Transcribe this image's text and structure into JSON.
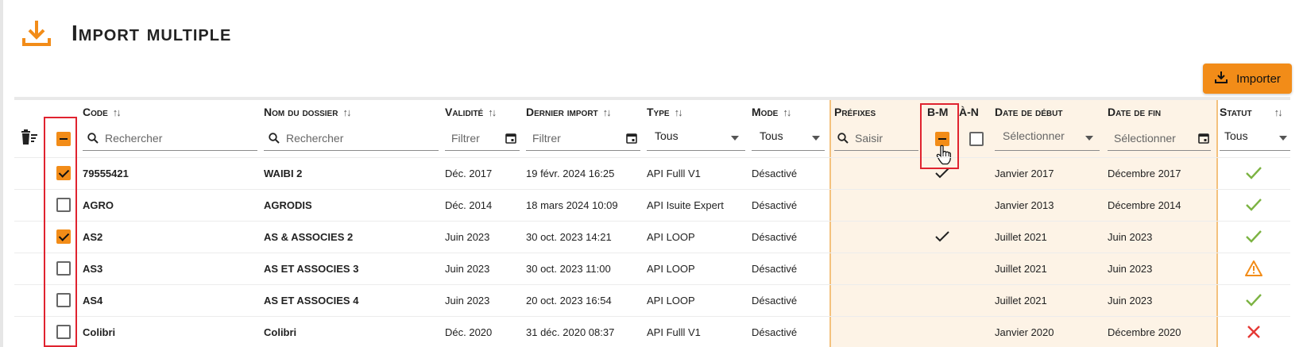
{
  "page": {
    "title": "Import multiple"
  },
  "toolbar": {
    "import_label": "Importer"
  },
  "columns": {
    "code": "Code",
    "nom": "Nom du dossier",
    "validite": "Validité",
    "dernier_import": "Dernier import",
    "type": "Type",
    "mode": "Mode",
    "prefixes": "Préfixes",
    "bm": "B-M",
    "an": "À-N",
    "date_debut": "Date de début",
    "date_fin": "Date de fin",
    "statut": "Statut"
  },
  "filters": {
    "code": "Rechercher",
    "nom": "Rechercher",
    "validite": "Filtrer",
    "dernier_import": "Filtrer",
    "type": "Tous",
    "mode": "Tous",
    "prefixes": "Saisir",
    "date_debut": "Sélectionner",
    "date_fin": "Sélectionner",
    "statut": "Tous"
  },
  "rows": [
    {
      "selected": true,
      "code": "79555421",
      "nom": "WAIBI 2",
      "validite": "Déc. 2017",
      "dernier_import": "19 févr. 2024 16:25",
      "type": "API Fulll V1",
      "mode": "Désactivé",
      "bm": true,
      "date_debut": "Janvier 2017",
      "date_fin": "Décembre 2017",
      "statut": "ok"
    },
    {
      "selected": false,
      "code": "AGRO",
      "nom": "AGRODIS",
      "validite": "Déc. 2014",
      "dernier_import": "18 mars 2024 10:09",
      "type": "API Isuite Expert",
      "mode": "Désactivé",
      "bm": false,
      "date_debut": "Janvier 2013",
      "date_fin": "Décembre 2014",
      "statut": "ok"
    },
    {
      "selected": true,
      "code": "AS2",
      "nom": "AS & ASSOCIES 2",
      "validite": "Juin 2023",
      "dernier_import": "30 oct. 2023 14:21",
      "type": "API LOOP",
      "mode": "Désactivé",
      "bm": true,
      "date_debut": "Juillet 2021",
      "date_fin": "Juin 2023",
      "statut": "ok"
    },
    {
      "selected": false,
      "code": "AS3",
      "nom": "AS ET ASSOCIES 3",
      "validite": "Juin 2023",
      "dernier_import": "30 oct. 2023 11:00",
      "type": "API LOOP",
      "mode": "Désactivé",
      "bm": false,
      "date_debut": "Juillet 2021",
      "date_fin": "Juin 2023",
      "statut": "warning"
    },
    {
      "selected": false,
      "code": "AS4",
      "nom": "AS ET ASSOCIES 4",
      "validite": "Juin 2023",
      "dernier_import": "20 oct. 2023 16:54",
      "type": "API LOOP",
      "mode": "Désactivé",
      "bm": false,
      "date_debut": "Juillet 2021",
      "date_fin": "Juin 2023",
      "statut": "ok"
    },
    {
      "selected": false,
      "code": "Colibri",
      "nom": "Colibri",
      "validite": "Déc. 2020",
      "dernier_import": "31 déc. 2020 08:37",
      "type": "API Fulll V1",
      "mode": "Désactivé",
      "bm": false,
      "date_debut": "Janvier 2020",
      "date_fin": "Décembre 2020",
      "statut": "error"
    }
  ],
  "colors": {
    "accent": "#f28c18",
    "ok": "#7cb342",
    "warning": "#f28c18",
    "error": "#e53935",
    "highlight": "#e0232f"
  }
}
